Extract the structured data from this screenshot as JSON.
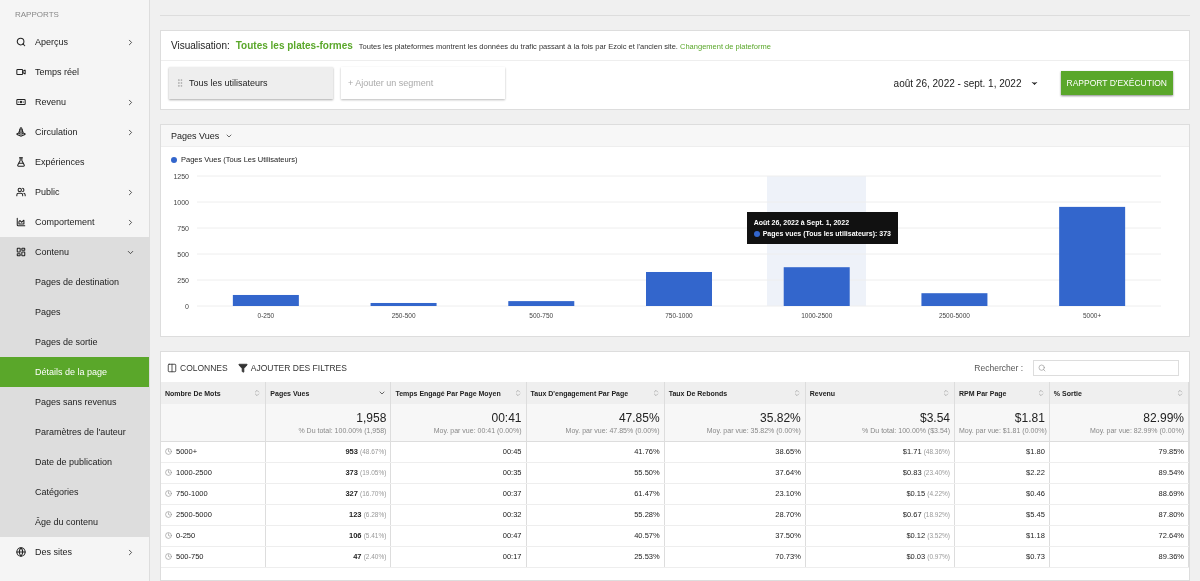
{
  "sidebar": {
    "heading": "RAPPORTS",
    "items": [
      {
        "label": "Aperçus",
        "has_arrow": true,
        "expanded": false
      },
      {
        "label": "Temps réel",
        "has_arrow": false,
        "expanded": false
      },
      {
        "label": "Revenu",
        "has_arrow": true,
        "expanded": false
      },
      {
        "label": "Circulation",
        "has_arrow": true,
        "expanded": false
      },
      {
        "label": "Expériences",
        "has_arrow": false,
        "expanded": false
      },
      {
        "label": "Public",
        "has_arrow": true,
        "expanded": false
      },
      {
        "label": "Comportement",
        "has_arrow": true,
        "expanded": false
      },
      {
        "label": "Contenu",
        "has_arrow": true,
        "expanded": true,
        "children": [
          {
            "label": "Pages de destination",
            "selected": false
          },
          {
            "label": "Pages",
            "selected": false
          },
          {
            "label": "Pages de sortie",
            "selected": false
          },
          {
            "label": "Détails de la page",
            "selected": true
          },
          {
            "label": "Pages sans revenus",
            "selected": false
          },
          {
            "label": "Paramètres de l'auteur",
            "selected": false
          },
          {
            "label": "Date de publication",
            "selected": false
          },
          {
            "label": "Catégories",
            "selected": false
          },
          {
            "label": "Âge du contenu",
            "selected": false
          }
        ]
      },
      {
        "label": "Des sites",
        "has_arrow": true,
        "expanded": false
      }
    ]
  },
  "visualization": {
    "label": "Visualisation:",
    "platform": "Toutes les plates-formes",
    "note": "Toutes les plateformes montrent les données du trafic passant à la fois par Ezoic et l'ancien site.",
    "link": "Changement de plateforme"
  },
  "segments": {
    "active": "Tous les utilisateurs",
    "placeholder": "+ Ajouter un segment"
  },
  "date_range": "août 26, 2022 - sept. 1, 2022",
  "run_button": "RAPPORT D'EXÉCUTION",
  "chart_panel": {
    "metric": "Pages Vues",
    "tooltip": {
      "title": "Août 26, 2022 à Sept. 1, 2022",
      "line": "Pages vues (Tous les utilisateurs): 373"
    },
    "hovered": [
      false,
      false,
      false,
      false,
      true,
      false,
      false
    ],
    "chart_data": {
      "type": "bar",
      "categories": [
        "0-250",
        "250-500",
        "500-750",
        "750-1000",
        "1000-2500",
        "2500-5000",
        "5000+"
      ],
      "series": [
        {
          "name": "Pages Vues (Tous Les Utilisateurs)",
          "color": "#3366cc",
          "values": [
            106,
            29,
            47,
            327,
            373,
            123,
            953
          ]
        }
      ],
      "ylim": [
        0,
        1250
      ],
      "yticks": [
        0,
        250,
        500,
        750,
        1000,
        1250
      ],
      "grid": true
    }
  },
  "table": {
    "toolbar": {
      "columns_button": "COLONNES",
      "filters_button": "AJOUTER DES FILTRES",
      "search_label": "Rechercher :"
    },
    "columns": [
      {
        "label": "Nombre De Mots",
        "sorted": false
      },
      {
        "label": "Pages Vues",
        "sorted": true
      },
      {
        "label": "Temps Engagé Par Page Moyen",
        "sorted": false
      },
      {
        "label": "Taux D'engagement Par Page",
        "sorted": false
      },
      {
        "label": "Taux De Rebonds",
        "sorted": false
      },
      {
        "label": "Revenu",
        "sorted": false
      },
      {
        "label": "RPM Par Page",
        "sorted": false
      },
      {
        "label": "% Sortie",
        "sorted": false
      }
    ],
    "totals": [
      {
        "value": "1,958",
        "sub": "% Du total: 100.00% (1,958)"
      },
      {
        "value": "00:41",
        "sub": "Moy. par vue: 00:41 (0.00%)"
      },
      {
        "value": "47.85%",
        "sub": "Moy. par vue: 47.85% (0.00%)"
      },
      {
        "value": "35.82%",
        "sub": "Moy. par vue: 35.82% (0.00%)"
      },
      {
        "value": "$3.54",
        "sub": "% Du total: 100.00% ($3.54)"
      },
      {
        "value": "$1.81",
        "sub": "Moy. par vue: $1.81 (0.00%)"
      },
      {
        "value": "82.99%",
        "sub": "Moy. par vue: 82.99% (0.00%)"
      }
    ],
    "rows": [
      [
        {
          "v": "5000+"
        },
        {
          "v": "953",
          "p": "(48.67%)"
        },
        {
          "v": "00:45"
        },
        {
          "v": "41.76%"
        },
        {
          "v": "38.65%"
        },
        {
          "v": "$1.71",
          "p": "(48.36%)"
        },
        {
          "v": "$1.80"
        },
        {
          "v": "79.85%"
        }
      ],
      [
        {
          "v": "1000-2500"
        },
        {
          "v": "373",
          "p": "(19.05%)"
        },
        {
          "v": "00:35"
        },
        {
          "v": "55.50%"
        },
        {
          "v": "37.64%"
        },
        {
          "v": "$0.83",
          "p": "(23.40%)"
        },
        {
          "v": "$2.22"
        },
        {
          "v": "89.54%"
        }
      ],
      [
        {
          "v": "750-1000"
        },
        {
          "v": "327",
          "p": "(16.70%)"
        },
        {
          "v": "00:37"
        },
        {
          "v": "61.47%"
        },
        {
          "v": "23.10%"
        },
        {
          "v": "$0.15",
          "p": "(4.22%)"
        },
        {
          "v": "$0.46"
        },
        {
          "v": "88.69%"
        }
      ],
      [
        {
          "v": "2500-5000"
        },
        {
          "v": "123",
          "p": "(6.28%)"
        },
        {
          "v": "00:32"
        },
        {
          "v": "55.28%"
        },
        {
          "v": "28.70%"
        },
        {
          "v": "$0.67",
          "p": "(18.92%)"
        },
        {
          "v": "$5.45"
        },
        {
          "v": "87.80%"
        }
      ],
      [
        {
          "v": "0-250"
        },
        {
          "v": "106",
          "p": "(5.41%)"
        },
        {
          "v": "00:47"
        },
        {
          "v": "40.57%"
        },
        {
          "v": "37.50%"
        },
        {
          "v": "$0.12",
          "p": "(3.52%)"
        },
        {
          "v": "$1.18"
        },
        {
          "v": "72.64%"
        }
      ],
      [
        {
          "v": "500-750"
        },
        {
          "v": "47",
          "p": "(2.40%)"
        },
        {
          "v": "00:17"
        },
        {
          "v": "25.53%"
        },
        {
          "v": "70.73%"
        },
        {
          "v": "$0.03",
          "p": "(0.97%)"
        },
        {
          "v": "$0.73"
        },
        {
          "v": "89.36%"
        }
      ]
    ]
  }
}
